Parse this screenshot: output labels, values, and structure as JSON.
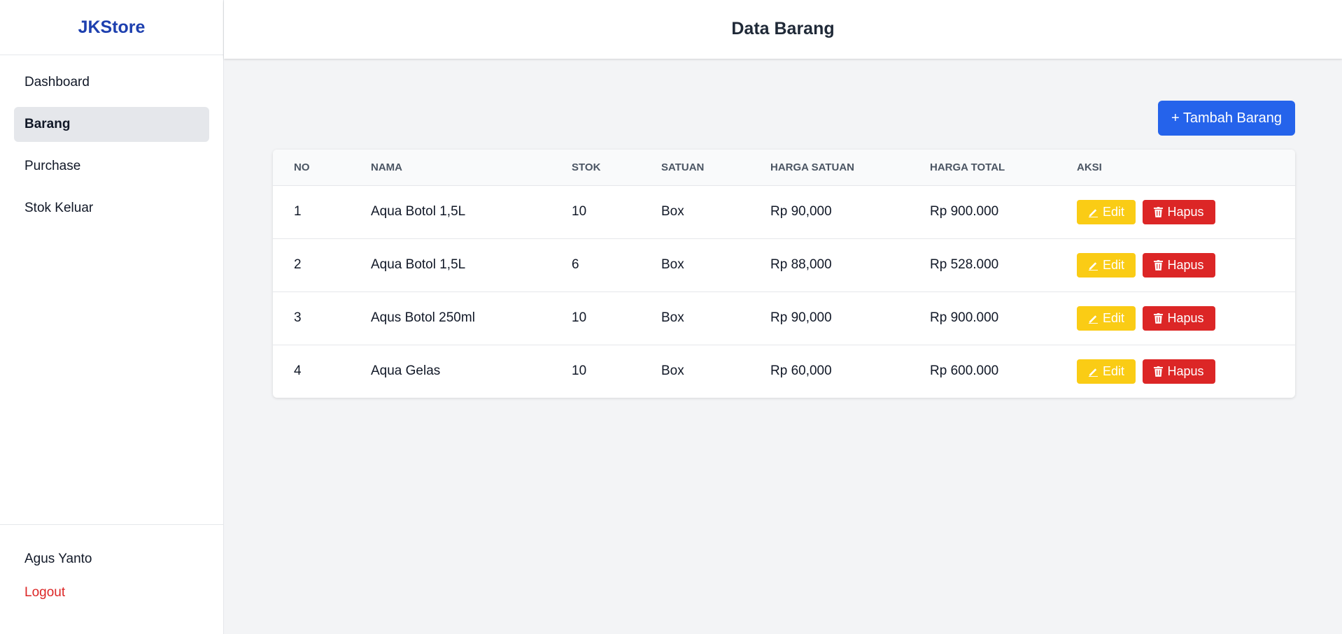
{
  "brand": "JKStore",
  "header": {
    "title": "Data Barang"
  },
  "sidebar": {
    "items": [
      {
        "label": "Dashboard",
        "active": false
      },
      {
        "label": "Barang",
        "active": true
      },
      {
        "label": "Purchase",
        "active": false
      },
      {
        "label": "Stok Keluar",
        "active": false
      }
    ],
    "user": "Agus Yanto",
    "logout": "Logout"
  },
  "main": {
    "add_button": "+ Tambah Barang",
    "table": {
      "columns": [
        "NO",
        "NAMA",
        "STOK",
        "SATUAN",
        "HARGA SATUAN",
        "HARGA TOTAL",
        "AKSI"
      ],
      "edit_label": "Edit",
      "delete_label": "Hapus",
      "rows": [
        {
          "no": "1",
          "nama": "Aqua Botol 1,5L",
          "stok": "10",
          "satuan": "Box",
          "harga_satuan": "Rp 90,000",
          "harga_total": "Rp 900.000"
        },
        {
          "no": "2",
          "nama": "Aqua Botol 1,5L",
          "stok": "6",
          "satuan": "Box",
          "harga_satuan": "Rp 88,000",
          "harga_total": "Rp 528.000"
        },
        {
          "no": "3",
          "nama": "Aqus Botol 250ml",
          "stok": "10",
          "satuan": "Box",
          "harga_satuan": "Rp 90,000",
          "harga_total": "Rp 900.000"
        },
        {
          "no": "4",
          "nama": "Aqua Gelas",
          "stok": "10",
          "satuan": "Box",
          "harga_satuan": "Rp 60,000",
          "harga_total": "Rp 600.000"
        }
      ]
    }
  },
  "colors": {
    "brand": "#1e40af",
    "primary": "#2563eb",
    "edit": "#facc15",
    "delete": "#dc2626",
    "logout": "#dc2626"
  },
  "icons": {
    "edit": "pencil-icon",
    "delete": "trash-icon"
  }
}
